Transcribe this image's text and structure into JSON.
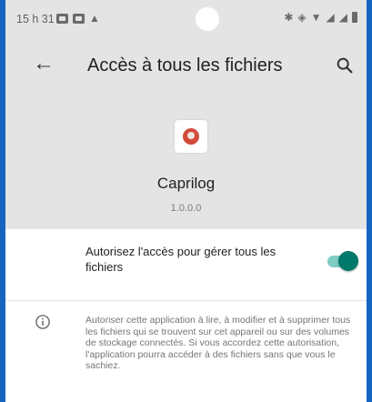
{
  "status_bar": {
    "time": "15 h 31",
    "notification_icons": [
      "message-icon",
      "message-icon",
      "warning-triangle-icon"
    ],
    "system_icons": [
      "bluetooth-icon",
      "vibrate-icon",
      "wifi-icon",
      "signal-icon",
      "signal-icon",
      "battery-icon"
    ]
  },
  "app_bar": {
    "title": "Accès à tous les fichiers",
    "back_icon": "arrow-back-icon",
    "search_icon": "search-icon"
  },
  "app_header": {
    "name": "Caprilog",
    "version": "1.0.0.0",
    "icon": "app-logo-icon"
  },
  "setting": {
    "label": "Autorisez l'accès pour gérer tous les fichiers",
    "enabled": true,
    "accent_color": "#00796b"
  },
  "info": {
    "icon": "info-icon",
    "text": "Autoriser cette application à lire, à modifier et à supprimer tous les fichiers qui se trouvent sur cet appareil ou sur des volumes de stockage connectés. Si vous accordez cette autorisation, l'application pourra accéder à des fichiers sans que vous le sachiez."
  }
}
